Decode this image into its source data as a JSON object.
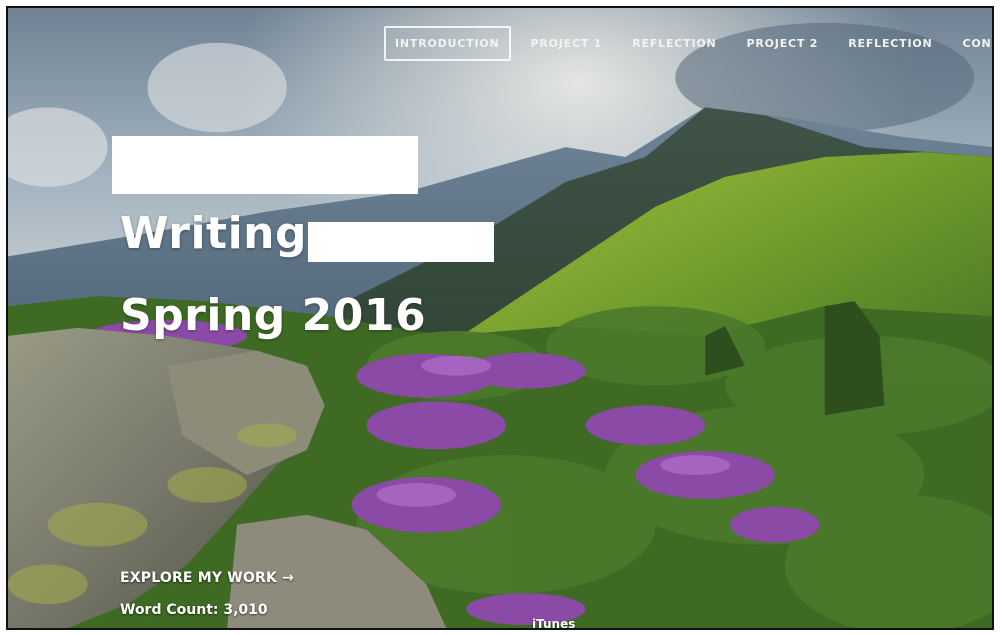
{
  "nav": {
    "items": [
      {
        "label": "INTRODUCTION",
        "active": true
      },
      {
        "label": "PROJECT 1",
        "active": false
      },
      {
        "label": "REFLECTION",
        "active": false
      },
      {
        "label": "PROJECT 2",
        "active": false
      },
      {
        "label": "REFLECTION",
        "active": false
      },
      {
        "label": "CONCLUSION",
        "active": false
      }
    ]
  },
  "hero": {
    "line1": "Writing",
    "line2": "Spring 2016"
  },
  "footer": {
    "explore": "EXPLORE MY WORK →",
    "word_count": "Word Count: 3,010",
    "itunes": "iTunes"
  },
  "colors": {
    "nav_text": "#f2f4f2",
    "heading": "#ffffff",
    "redaction": "#ffffff",
    "frame_border": "#111111"
  }
}
